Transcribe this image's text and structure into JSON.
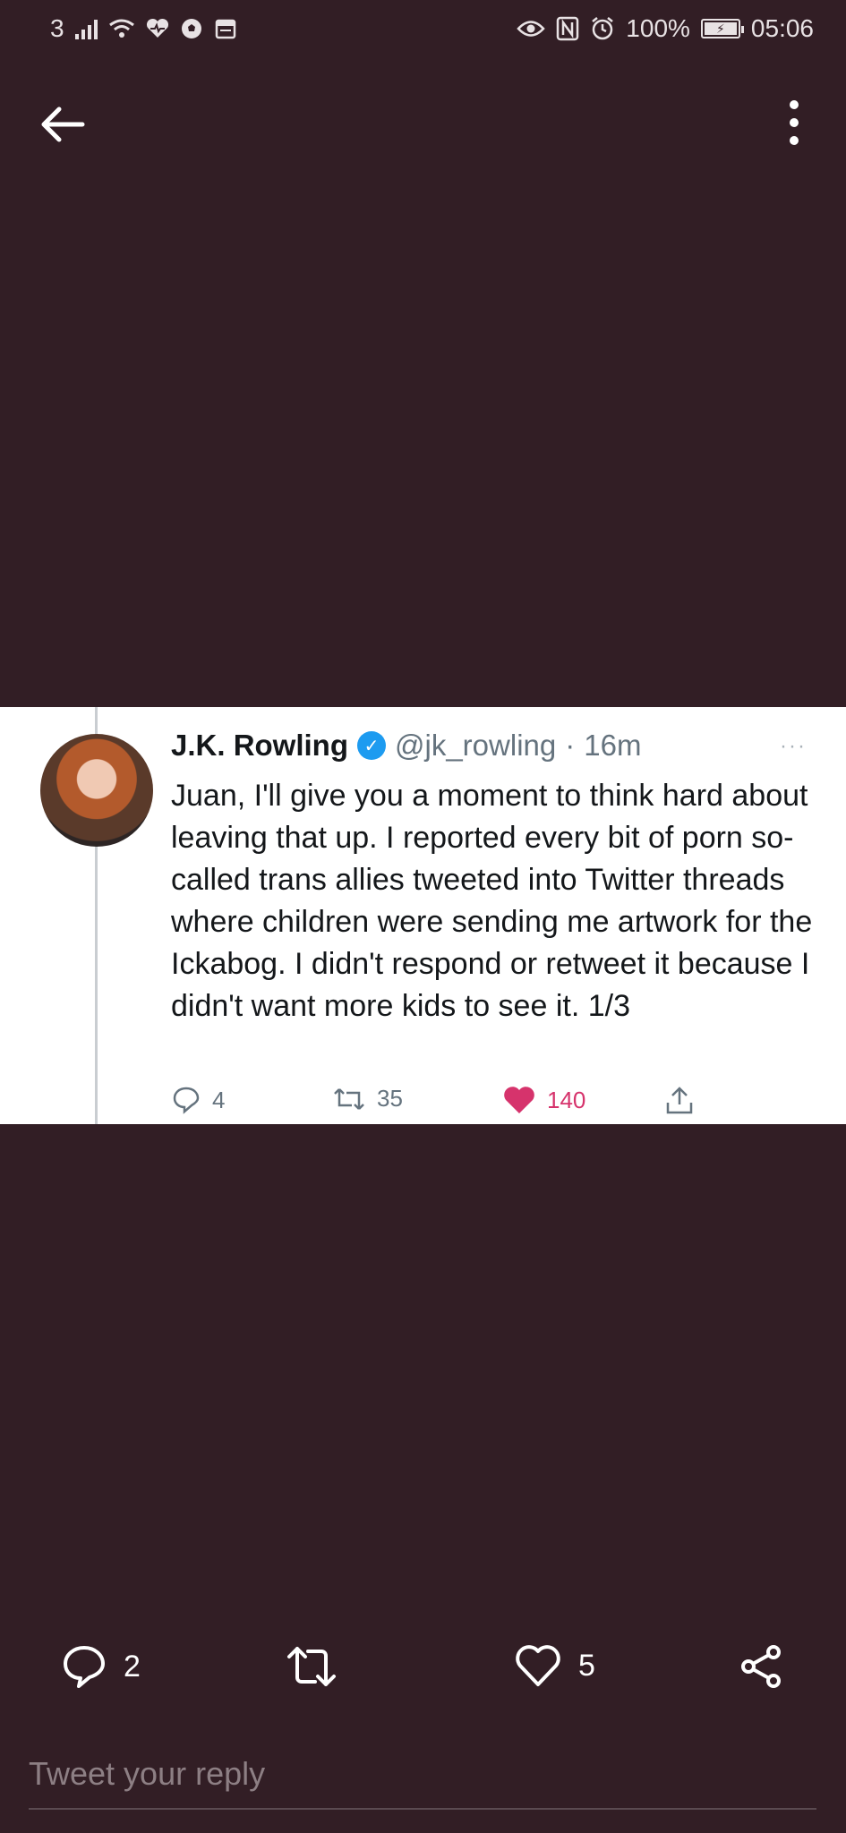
{
  "status_bar": {
    "sim": "3",
    "battery_percent": "100%",
    "time": "05:06",
    "left_icons": [
      "signal-icon",
      "wifi-icon",
      "health-icon",
      "soccer-icon",
      "calendar-icon"
    ],
    "right_icons": [
      "eye-icon",
      "nfc-icon",
      "alarm-icon",
      "battery-icon"
    ]
  },
  "nav": {
    "back_icon": "arrow-left-icon",
    "menu_icon": "more-vertical-icon"
  },
  "embedded_tweet": {
    "author_name": "J.K. Rowling",
    "handle": "@jk_rowling",
    "separator": "·",
    "time": "16m",
    "more": "···",
    "text": "Juan, I'll give you a moment to think hard about leaving that up. I reported every bit of porn so-called trans allies tweeted into Twitter threads where children were sending me artwork for the Ickabog. I didn't respond or retweet it because I didn't want more kids to see it. 1/3",
    "replies": "4",
    "retweets": "35",
    "likes": "140",
    "like_color": "#d6336c"
  },
  "actions": {
    "reply_count": "2",
    "like_count": "5"
  },
  "reply": {
    "placeholder": "Tweet your reply"
  },
  "colors": {
    "background": "#321e25",
    "verified": "#1d9bf0"
  }
}
